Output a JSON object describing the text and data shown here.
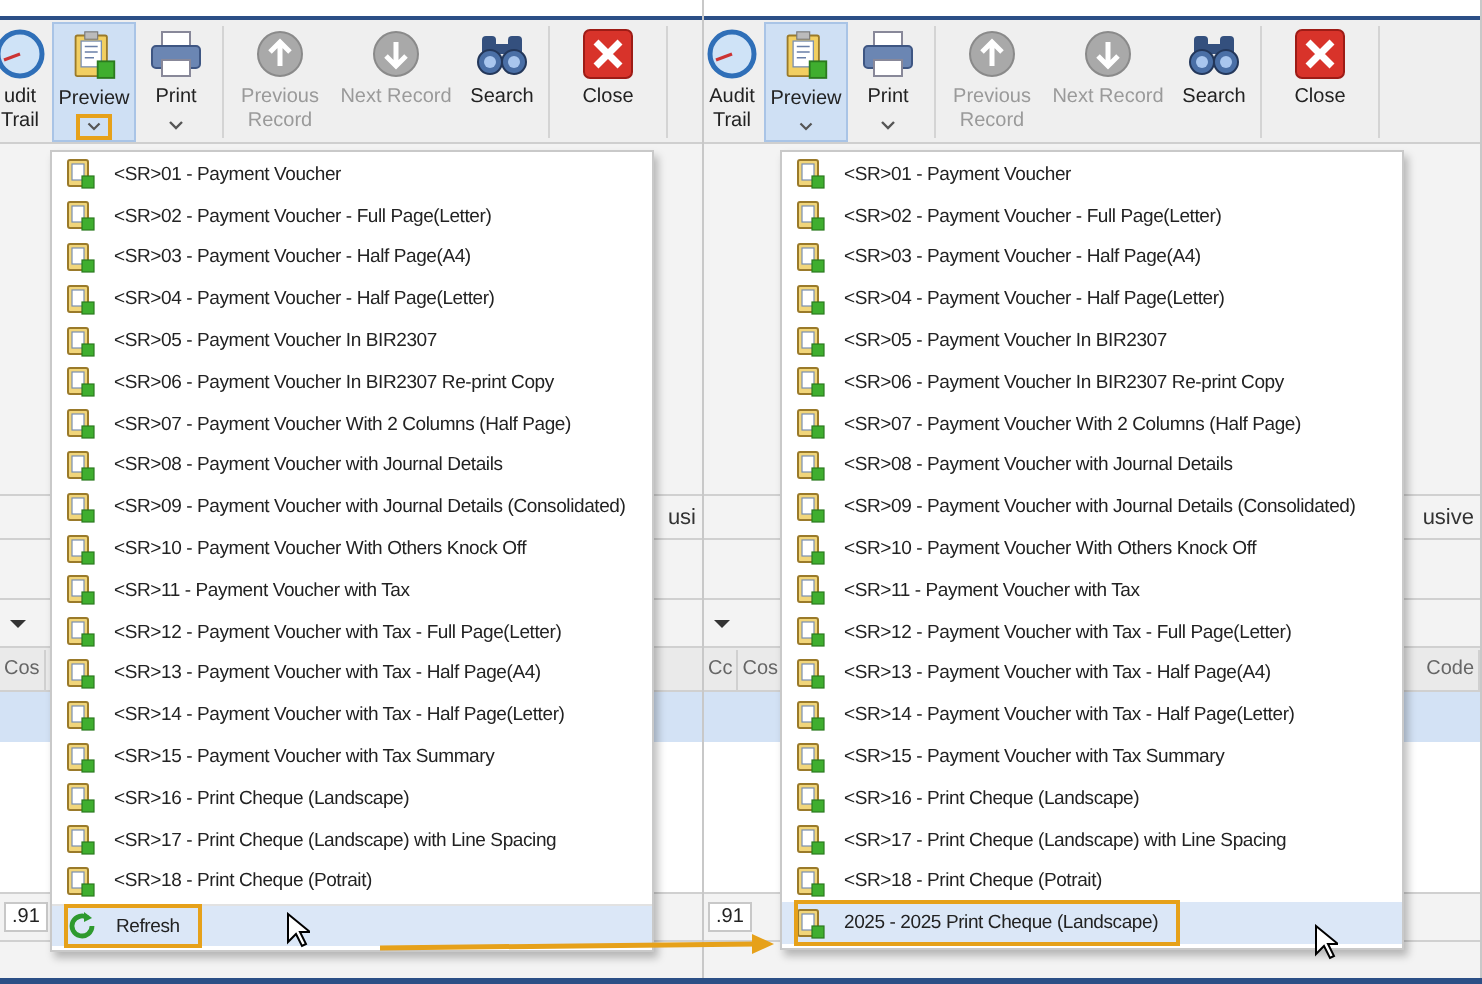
{
  "panels": [
    {
      "toolbar": [
        {
          "kind": "audit",
          "label": "udit Trail",
          "selected": false,
          "disabled": false
        },
        {
          "kind": "preview",
          "label": "Preview",
          "selected": true,
          "disabled": false,
          "dropdown": true,
          "highlighted": true
        },
        {
          "kind": "print",
          "label": "Print",
          "selected": false,
          "disabled": false,
          "dropdown": true,
          "highlighted": false
        },
        {
          "kind": "previous",
          "label": "Previous Record",
          "selected": false,
          "disabled": true
        },
        {
          "kind": "next",
          "label": "Next Record",
          "selected": false,
          "disabled": true
        },
        {
          "kind": "search",
          "label": "Search",
          "selected": false,
          "disabled": false
        },
        {
          "kind": "close",
          "label": "Close",
          "selected": false,
          "disabled": false
        }
      ],
      "background": {
        "side_label": "usi",
        "left_columns": [
          "Cos"
        ],
        "total": ".91"
      },
      "menu": [
        {
          "kind": "report",
          "label": "<SR>01 - Payment Voucher",
          "hovered": false,
          "highlighted": false
        },
        {
          "kind": "report",
          "label": "<SR>02 - Payment Voucher - Full Page(Letter)",
          "hovered": false,
          "highlighted": false
        },
        {
          "kind": "report",
          "label": "<SR>03 - Payment Voucher - Half Page(A4)",
          "hovered": false,
          "highlighted": false
        },
        {
          "kind": "report",
          "label": "<SR>04 - Payment Voucher - Half Page(Letter)",
          "hovered": false,
          "highlighted": false
        },
        {
          "kind": "report",
          "label": "<SR>05 - Payment Voucher In BIR2307",
          "hovered": false,
          "highlighted": false
        },
        {
          "kind": "report",
          "label": "<SR>06 - Payment Voucher In BIR2307 Re-print Copy",
          "hovered": false,
          "highlighted": false
        },
        {
          "kind": "report",
          "label": "<SR>07 - Payment Voucher With 2 Columns (Half Page)",
          "hovered": false,
          "highlighted": false
        },
        {
          "kind": "report",
          "label": "<SR>08 - Payment Voucher with Journal Details",
          "hovered": false,
          "highlighted": false
        },
        {
          "kind": "report",
          "label": "<SR>09 - Payment Voucher with Journal Details (Consolidated)",
          "hovered": false,
          "highlighted": false
        },
        {
          "kind": "report",
          "label": "<SR>10 - Payment Voucher With Others Knock Off",
          "hovered": false,
          "highlighted": false
        },
        {
          "kind": "report",
          "label": "<SR>11 - Payment Voucher with Tax",
          "hovered": false,
          "highlighted": false
        },
        {
          "kind": "report",
          "label": "<SR>12 - Payment Voucher with Tax - Full Page(Letter)",
          "hovered": false,
          "highlighted": false
        },
        {
          "kind": "report",
          "label": "<SR>13 - Payment Voucher with Tax - Half Page(A4)",
          "hovered": false,
          "highlighted": false
        },
        {
          "kind": "report",
          "label": "<SR>14 - Payment Voucher with Tax - Half Page(Letter)",
          "hovered": false,
          "highlighted": false
        },
        {
          "kind": "report",
          "label": "<SR>15 - Payment Voucher with Tax Summary",
          "hovered": false,
          "highlighted": false
        },
        {
          "kind": "report",
          "label": "<SR>16 - Print Cheque (Landscape)",
          "hovered": false,
          "highlighted": false
        },
        {
          "kind": "report",
          "label": "<SR>17 - Print Cheque (Landscape) with Line Spacing",
          "hovered": false,
          "highlighted": false
        },
        {
          "kind": "report",
          "label": "<SR>18 - Print Cheque (Potrait)",
          "hovered": false,
          "highlighted": false
        },
        {
          "kind": "refresh",
          "label": "Refresh",
          "hovered": true,
          "highlighted": true
        }
      ]
    },
    {
      "toolbar": [
        {
          "kind": "audit",
          "label": "Audit Trail",
          "selected": false,
          "disabled": false
        },
        {
          "kind": "preview",
          "label": "Preview",
          "selected": true,
          "disabled": false,
          "dropdown": true,
          "highlighted": false
        },
        {
          "kind": "print",
          "label": "Print",
          "selected": false,
          "disabled": false,
          "dropdown": true,
          "highlighted": false
        },
        {
          "kind": "previous",
          "label": "Previous Record",
          "selected": false,
          "disabled": true
        },
        {
          "kind": "next",
          "label": "Next Record",
          "selected": false,
          "disabled": true
        },
        {
          "kind": "search",
          "label": "Search",
          "selected": false,
          "disabled": false
        },
        {
          "kind": "close",
          "label": "Close",
          "selected": false,
          "disabled": false
        }
      ],
      "background": {
        "side_label": "usive",
        "left_columns": [
          "Cc",
          "Cos"
        ],
        "right_columns": [
          "Code"
        ],
        "total": ".91"
      },
      "menu": [
        {
          "kind": "report",
          "label": "<SR>01 - Payment Voucher",
          "hovered": false,
          "highlighted": false
        },
        {
          "kind": "report",
          "label": "<SR>02 - Payment Voucher - Full Page(Letter)",
          "hovered": false,
          "highlighted": false
        },
        {
          "kind": "report",
          "label": "<SR>03 - Payment Voucher - Half Page(A4)",
          "hovered": false,
          "highlighted": false
        },
        {
          "kind": "report",
          "label": "<SR>04 - Payment Voucher - Half Page(Letter)",
          "hovered": false,
          "highlighted": false
        },
        {
          "kind": "report",
          "label": "<SR>05 - Payment Voucher In BIR2307",
          "hovered": false,
          "highlighted": false
        },
        {
          "kind": "report",
          "label": "<SR>06 - Payment Voucher In BIR2307 Re-print Copy",
          "hovered": false,
          "highlighted": false
        },
        {
          "kind": "report",
          "label": "<SR>07 - Payment Voucher With 2 Columns (Half Page)",
          "hovered": false,
          "highlighted": false
        },
        {
          "kind": "report",
          "label": "<SR>08 - Payment Voucher with Journal Details",
          "hovered": false,
          "highlighted": false
        },
        {
          "kind": "report",
          "label": "<SR>09 - Payment Voucher with Journal Details (Consolidated)",
          "hovered": false,
          "highlighted": false
        },
        {
          "kind": "report",
          "label": "<SR>10 - Payment Voucher With Others Knock Off",
          "hovered": false,
          "highlighted": false
        },
        {
          "kind": "report",
          "label": "<SR>11 - Payment Voucher with Tax",
          "hovered": false,
          "highlighted": false
        },
        {
          "kind": "report",
          "label": "<SR>12 - Payment Voucher with Tax - Full Page(Letter)",
          "hovered": false,
          "highlighted": false
        },
        {
          "kind": "report",
          "label": "<SR>13 - Payment Voucher with Tax - Half Page(A4)",
          "hovered": false,
          "highlighted": false
        },
        {
          "kind": "report",
          "label": "<SR>14 - Payment Voucher with Tax - Half Page(Letter)",
          "hovered": false,
          "highlighted": false
        },
        {
          "kind": "report",
          "label": "<SR>15 - Payment Voucher with Tax Summary",
          "hovered": false,
          "highlighted": false
        },
        {
          "kind": "report",
          "label": "<SR>16 - Print Cheque (Landscape)",
          "hovered": false,
          "highlighted": false
        },
        {
          "kind": "report",
          "label": "<SR>17 - Print Cheque (Landscape) with Line Spacing",
          "hovered": false,
          "highlighted": false
        },
        {
          "kind": "report",
          "label": "<SR>18 - Print Cheque (Potrait)",
          "hovered": false,
          "highlighted": false
        },
        {
          "kind": "report",
          "label": "2025 - 2025 Print Cheque (Landscape)",
          "hovered": true,
          "highlighted": true
        }
      ]
    }
  ]
}
